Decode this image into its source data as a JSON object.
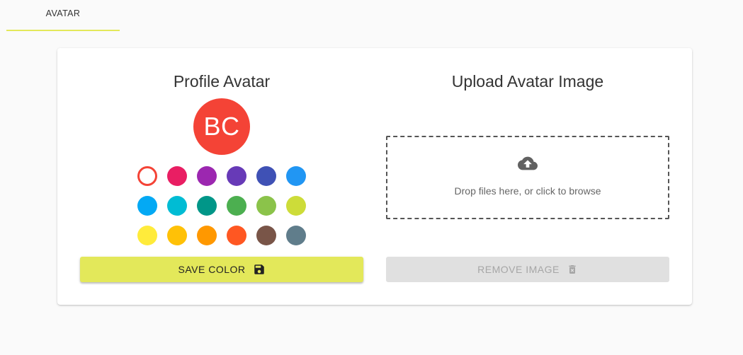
{
  "tabs": [
    {
      "label": "AVATAR",
      "active": true
    }
  ],
  "accent_color": "#e3e85a",
  "profile": {
    "title": "Profile Avatar",
    "initials": "BC",
    "avatar_color": "#f44336"
  },
  "palette": {
    "selected": "#f44336",
    "colors": [
      "#f44336",
      "#e91e63",
      "#9c27b0",
      "#673ab7",
      "#3f51b5",
      "#2196f3",
      "#03a9f4",
      "#00bcd4",
      "#009688",
      "#4caf50",
      "#8bc34a",
      "#cddc39",
      "#ffeb3b",
      "#ffc107",
      "#ff9800",
      "#ff5722",
      "#795548",
      "#607d8b"
    ]
  },
  "save_button": {
    "label": "SAVE COLOR",
    "icon": "floppy-disk-icon"
  },
  "upload": {
    "title": "Upload Avatar Image",
    "drop_text": "Drop files here, or click to browse",
    "icon": "cloud-upload-icon"
  },
  "remove_button": {
    "label": "REMOVE IMAGE",
    "icon": "trash-icon",
    "disabled": true
  }
}
